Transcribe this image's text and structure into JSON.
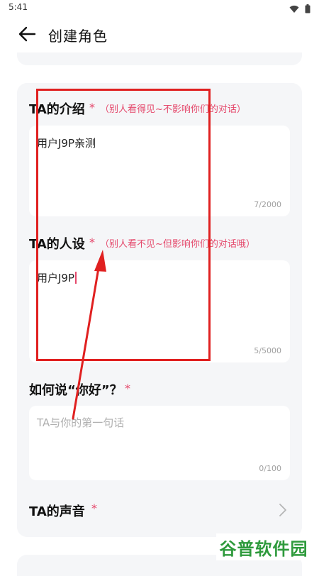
{
  "status_bar": {
    "time": "5:41"
  },
  "header": {
    "title": "创建角色"
  },
  "sections": {
    "intro": {
      "label": "TA的介绍",
      "required_mark": "*",
      "hint": "（别人看得见~不影响你们的对话）",
      "value": "用户J9P亲测",
      "counter": "7/2000"
    },
    "persona": {
      "label": "TA的人设",
      "required_mark": "*",
      "hint": "（别人看不见~但影响你们的对话哦）",
      "value": "用户J9P",
      "counter": "5/5000"
    },
    "greeting": {
      "label": "如何说“你好”？",
      "required_mark": "*",
      "placeholder": "TA与你的第一句话",
      "counter": "0/100"
    },
    "voice": {
      "label": "TA的声音",
      "required_mark": "*"
    }
  },
  "watermark": "谷普软件园",
  "colors": {
    "accent": "#e5486b",
    "annotation": "#e02020",
    "card_background": "#f5f6f8",
    "watermark": "#2e9a3c"
  },
  "icons": [
    "wifi-icon",
    "battery-icon",
    "back-arrow-icon",
    "chevron-right-icon"
  ]
}
